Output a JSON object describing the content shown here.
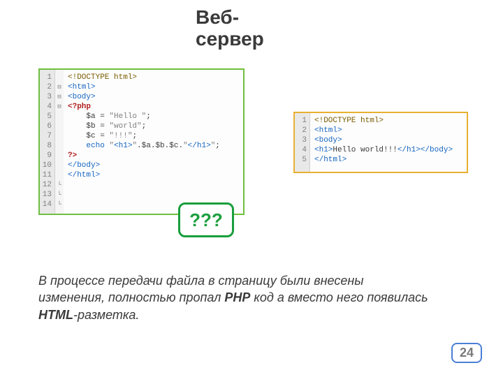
{
  "title": "Веб-сервер",
  "left_code": {
    "lines": [
      "1",
      "2",
      "3",
      "4",
      "5",
      "6",
      "7",
      "8",
      "9",
      "10",
      "11",
      "12",
      "13",
      "14"
    ],
    "fold": [
      "",
      "⊟",
      "⊟",
      "⊟",
      "",
      "",
      "",
      "",
      "",
      "",
      "",
      "└",
      "└",
      "└"
    ],
    "rows": [
      [
        {
          "c": "c-brn",
          "t": "<!DOCTYPE html>"
        }
      ],
      [
        {
          "c": "c-tag",
          "t": "<html>"
        }
      ],
      [
        {
          "c": "c-tag",
          "t": "<body>"
        }
      ],
      [
        {
          "c": "c-php",
          "t": "<?php"
        }
      ],
      [
        {
          "c": "",
          "t": ""
        }
      ],
      [
        {
          "c": "c-var",
          "t": "    $a = "
        },
        {
          "c": "c-str",
          "t": "\"Hello \""
        },
        {
          "c": "c-var",
          "t": ";"
        }
      ],
      [
        {
          "c": "c-var",
          "t": "    $b = "
        },
        {
          "c": "c-str",
          "t": "\"world\""
        },
        {
          "c": "c-var",
          "t": ";"
        }
      ],
      [
        {
          "c": "c-var",
          "t": "    $c = "
        },
        {
          "c": "c-str",
          "t": "\"!!!\""
        },
        {
          "c": "c-var",
          "t": ";"
        }
      ],
      [
        {
          "c": "",
          "t": ""
        }
      ],
      [
        {
          "c": "c-kw",
          "t": "    echo "
        },
        {
          "c": "c-str",
          "t": "\""
        },
        {
          "c": "c-tag",
          "t": "<h1>"
        },
        {
          "c": "c-str",
          "t": "\""
        },
        {
          "c": "c-var",
          "t": ".$a.$b.$c."
        },
        {
          "c": "c-str",
          "t": "\""
        },
        {
          "c": "c-tag",
          "t": "</h1>"
        },
        {
          "c": "c-str",
          "t": "\""
        },
        {
          "c": "c-var",
          "t": ";"
        }
      ],
      [
        {
          "c": "",
          "t": ""
        }
      ],
      [
        {
          "c": "c-php",
          "t": "?>"
        }
      ],
      [
        {
          "c": "c-tag",
          "t": "</body>"
        }
      ],
      [
        {
          "c": "c-tag",
          "t": "</html>"
        }
      ]
    ]
  },
  "right_code": {
    "lines": [
      "1",
      "2",
      "3",
      "4",
      "5"
    ],
    "rows": [
      [
        {
          "c": "c-brn",
          "t": "<!DOCTYPE html>"
        }
      ],
      [
        {
          "c": "c-tag",
          "t": "<html>"
        }
      ],
      [
        {
          "c": "c-tag",
          "t": "<body>"
        }
      ],
      [
        {
          "c": "c-tag",
          "t": "<h1>"
        },
        {
          "c": "c-var",
          "t": "Hello world!!!"
        },
        {
          "c": "c-tag",
          "t": "</h1></body>"
        }
      ],
      [
        {
          "c": "c-tag",
          "t": "</html>"
        }
      ]
    ]
  },
  "question": "???",
  "paragraph": {
    "pre": "В процессе передачи файла в страницу были внесены изменения, полностью пропал ",
    "b1": "PHP",
    "mid": " код а вместо него появилась ",
    "b2": "HTML",
    "post": "-разметка."
  },
  "page": "24"
}
